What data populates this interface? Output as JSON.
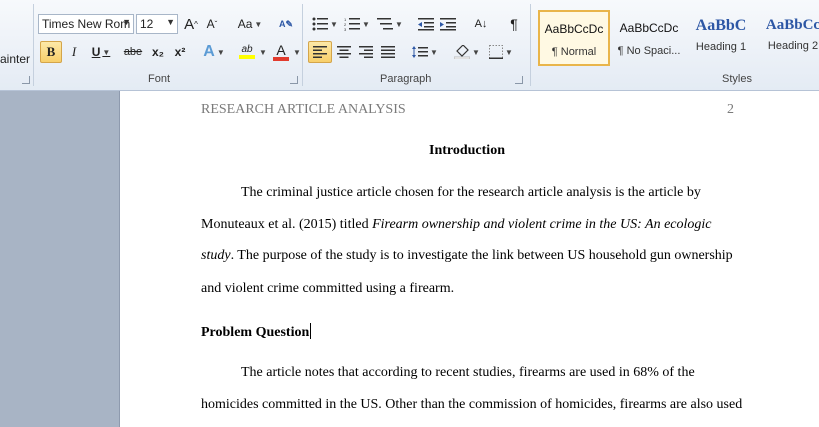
{
  "ribbon": {
    "clipboard": {
      "label_partial": "ainter"
    },
    "font": {
      "group_label": "Font",
      "font_name": "Times New Rom",
      "font_size": "12",
      "grow_label": "A",
      "shrink_label": "A",
      "change_case_label": "Aa",
      "bold_label": "B",
      "italic_label": "I",
      "underline_label": "U",
      "strikethrough_label": "abe",
      "subscript_label": "x₂",
      "superscript_label": "x²",
      "text_effects_label": "A",
      "highlight_label": "ab",
      "font_color_label": "A"
    },
    "paragraph": {
      "group_label": "Paragraph"
    },
    "styles": {
      "group_label": "Styles",
      "items": [
        {
          "sample": "AaBbCcDc",
          "name": "¶ Normal"
        },
        {
          "sample": "AaBbCcDc",
          "name": "¶ No Spaci..."
        },
        {
          "sample": "AaBbC",
          "name": "Heading 1"
        },
        {
          "sample": "AaBbCc",
          "name": "Heading 2"
        }
      ]
    }
  },
  "colors": {
    "highlight": "#ffff00",
    "font_color": "#e23b2e",
    "heading_blue": "#2d57a5"
  },
  "document": {
    "running_header": "RESEARCH ARTICLE ANALYSIS",
    "page_number": "2",
    "title": "Introduction",
    "p1": {
      "line1": "The criminal justice article chosen for the research article analysis is the article by",
      "line2_plain": "Monuteaux et al. (2015) titled ",
      "line2_italic": "Firearm ownership and violent crime in the US: An ecologic",
      "line3_italic": "study",
      "line3_plain": ". The purpose of the study is to investigate the link between US household gun ownership",
      "line4": "and violent crime committed using a firearm."
    },
    "heading2": "Problem Question",
    "p2": {
      "line1": "The article notes that according to recent studies, firearms are used in 68% of the",
      "line2": "homicides committed in the US. Other than the commission of homicides, firearms are also used"
    }
  }
}
